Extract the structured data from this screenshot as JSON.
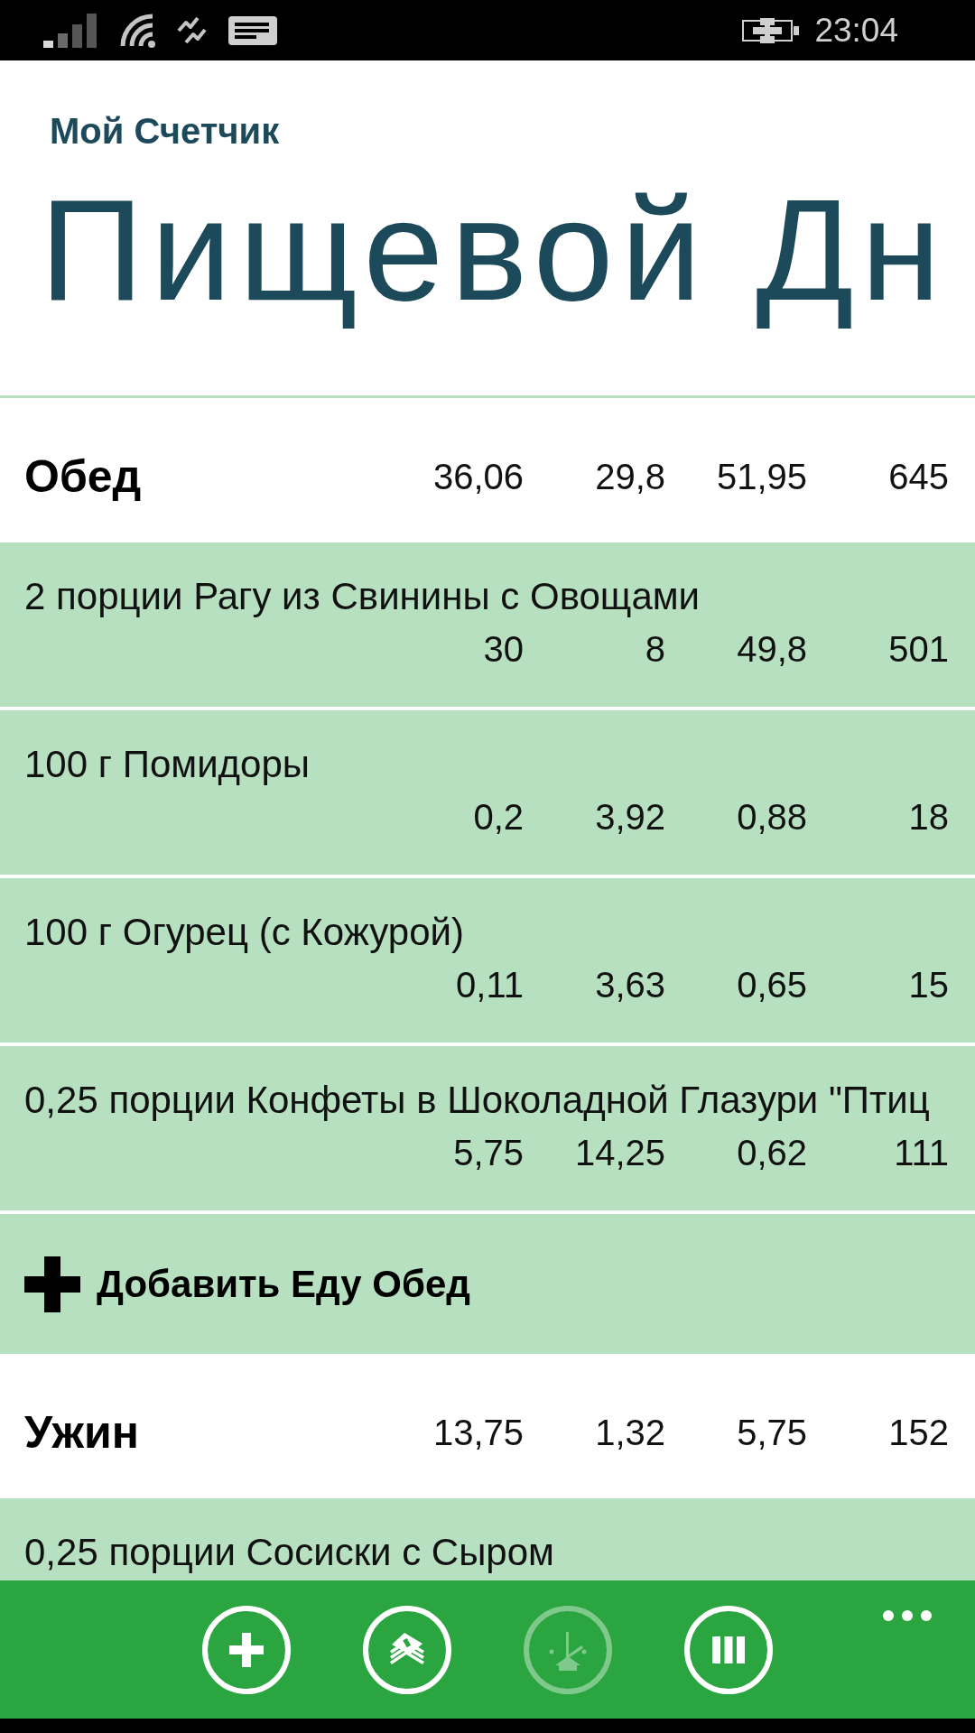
{
  "status_bar": {
    "time": "23:04"
  },
  "header": {
    "app_name": "Мой Счетчик",
    "page_title": "Пищевой Дн"
  },
  "meals": [
    {
      "name": "Обед",
      "totals": [
        "36,06",
        "29,8",
        "51,95",
        "645"
      ],
      "items": [
        {
          "name": "2 порции Рагу из Свинины с Овощами",
          "values": [
            "30",
            "8",
            "49,8",
            "501"
          ]
        },
        {
          "name": "100 г Помидоры",
          "values": [
            "0,2",
            "3,92",
            "0,88",
            "18"
          ]
        },
        {
          "name": "100 г Огурец (с Кожурой)",
          "values": [
            "0,11",
            "3,63",
            "0,65",
            "15"
          ]
        },
        {
          "name": "0,25 порции Конфеты в Шоколадной Глазури \"Птиц",
          "values": [
            "5,75",
            "14,25",
            "0,62",
            "111"
          ]
        }
      ],
      "add_label": "Добавить Еду Обед"
    },
    {
      "name": "Ужин",
      "totals": [
        "13,75",
        "1,32",
        "5,75",
        "152"
      ],
      "items": [
        {
          "name": "0,25 порции Сосиски с Сыром"
        }
      ]
    }
  ],
  "app_bar": {
    "buttons": [
      {
        "kind": "add",
        "disabled": false
      },
      {
        "kind": "pages",
        "disabled": false
      },
      {
        "kind": "clock",
        "disabled": true
      },
      {
        "kind": "columns",
        "disabled": false
      }
    ]
  }
}
